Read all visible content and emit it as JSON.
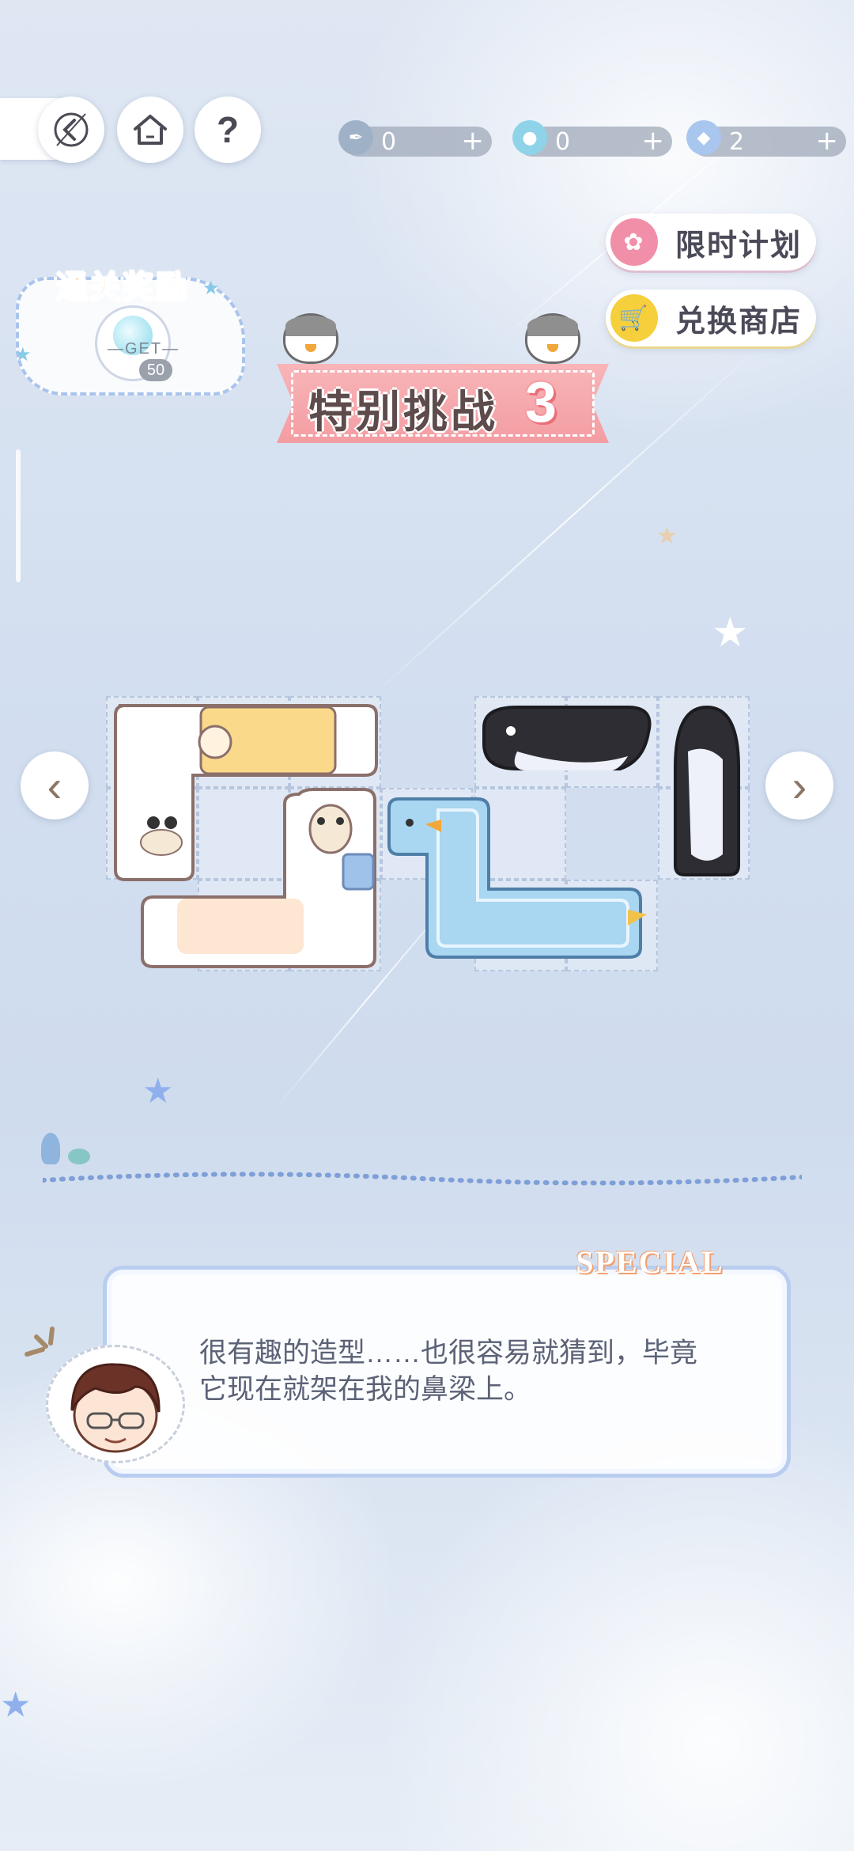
{
  "nav": {
    "back_icon": "back-arrow-icon",
    "home_icon": "home-icon",
    "help_label": "?"
  },
  "resources": [
    {
      "icon": "feather-icon",
      "value": "0",
      "plus": "+"
    },
    {
      "icon": "lollipop-icon",
      "value": "0",
      "plus": "+"
    },
    {
      "icon": "gem-icon",
      "value": "2",
      "plus": "+"
    }
  ],
  "side_buttons": {
    "plan_label": "限时计划",
    "shop_label": "兑换商店"
  },
  "reward": {
    "title": "通关奖励",
    "get_label": "GET",
    "quantity": "50"
  },
  "banner": {
    "title": "特别挑战",
    "number": "3"
  },
  "dialog": {
    "badge": "SPECIAL",
    "text_line1": "很有趣的造型……也很容易就猜到，毕竟",
    "text_line2": "它现在就架在我的鼻梁上。"
  },
  "colors": {
    "banner_pink": "#f39da2",
    "reward_orange": "#f4a63a",
    "dialog_border": "#b9cdf0",
    "cell_border": "#b6c6de"
  }
}
